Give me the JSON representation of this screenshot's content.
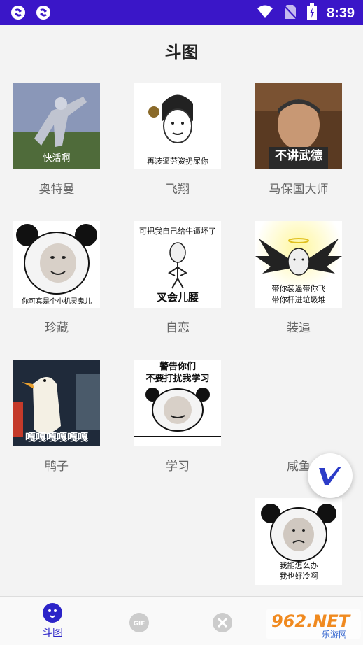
{
  "status": {
    "time": "8:39"
  },
  "page": {
    "title": "斗图"
  },
  "items": [
    {
      "label": "奥特曼",
      "caption": "快活啊"
    },
    {
      "label": "飞翔",
      "caption": "再装逼劳资扔屎你"
    },
    {
      "label": "马保国大师",
      "caption": "不讲武德"
    },
    {
      "label": "珍藏",
      "caption": "你可真是个小机灵鬼儿"
    },
    {
      "label": "自恋",
      "caption_top": "可把我自己给牛逼坏了",
      "caption": "叉会儿腰"
    },
    {
      "label": "装逼",
      "caption_line1": "带你装逼带你飞",
      "caption_line2": "带你杆进垃圾堆"
    },
    {
      "label": "鸭子",
      "caption": "嘎嘎嘎嘎嘎嘎"
    },
    {
      "label": "学习",
      "caption_line1": "警告你们",
      "caption_line2": "不要打扰我学习"
    },
    {
      "label": "咸鱼"
    },
    {
      "caption_line1": "我能怎么办",
      "caption_line2": "我也好冷啊"
    }
  ],
  "bottom_nav": {
    "tab1_label": "斗图",
    "tab2_icon_text": "GIF"
  },
  "watermark": {
    "brand": "962.NET",
    "sub": "乐游网"
  }
}
